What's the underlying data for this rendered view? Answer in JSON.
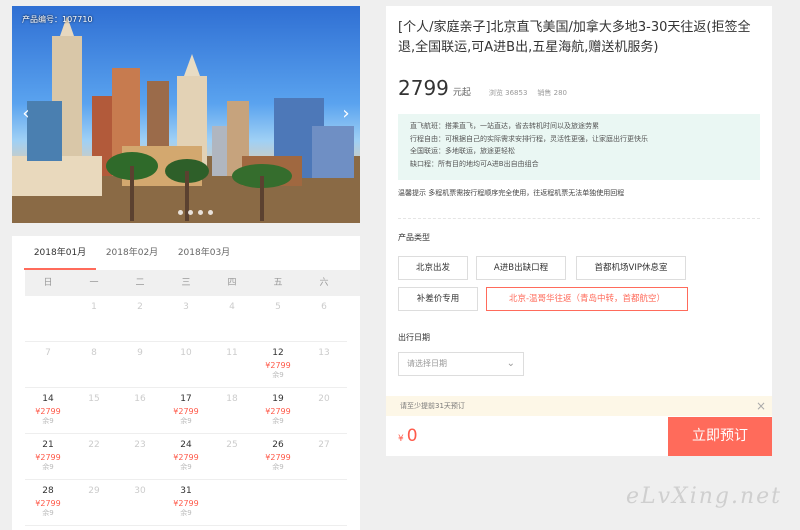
{
  "gallery": {
    "product_code": "产品编号：107710",
    "prev": "‹",
    "next": "›"
  },
  "calendar": {
    "months": [
      "2018年01月",
      "2018年02月",
      "2018年03月"
    ],
    "weekdays": [
      "日",
      "一",
      "二",
      "三",
      "四",
      "五",
      "六"
    ],
    "weeks": [
      [
        {
          "d": ""
        },
        {
          "d": "1",
          "dim": true
        },
        {
          "d": "2",
          "dim": true
        },
        {
          "d": "3",
          "dim": true
        },
        {
          "d": "4",
          "dim": true
        },
        {
          "d": "5",
          "dim": true
        },
        {
          "d": "6",
          "dim": true
        }
      ],
      [
        {
          "d": "7",
          "dim": true
        },
        {
          "d": "8",
          "dim": true
        },
        {
          "d": "9",
          "dim": true
        },
        {
          "d": "10",
          "dim": true
        },
        {
          "d": "11",
          "dim": true
        },
        {
          "d": "12",
          "p": "¥2799",
          "s": "余9"
        },
        {
          "d": "13",
          "dim": true
        }
      ],
      [
        {
          "d": "14",
          "p": "¥2799",
          "s": "余9"
        },
        {
          "d": "15",
          "dim": true
        },
        {
          "d": "16",
          "dim": true
        },
        {
          "d": "17",
          "p": "¥2799",
          "s": "余9"
        },
        {
          "d": "18",
          "dim": true
        },
        {
          "d": "19",
          "p": "¥2799",
          "s": "余9"
        },
        {
          "d": "20",
          "dim": true
        }
      ],
      [
        {
          "d": "21",
          "p": "¥2799",
          "s": "余9"
        },
        {
          "d": "22",
          "dim": true
        },
        {
          "d": "23",
          "dim": true
        },
        {
          "d": "24",
          "p": "¥2799",
          "s": "余9"
        },
        {
          "d": "25",
          "dim": true
        },
        {
          "d": "26",
          "p": "¥2799",
          "s": "余9"
        },
        {
          "d": "27",
          "dim": true
        }
      ],
      [
        {
          "d": "28",
          "p": "¥2799",
          "s": "余9"
        },
        {
          "d": "29",
          "dim": true
        },
        {
          "d": "30",
          "dim": true
        },
        {
          "d": "31",
          "p": "¥2799",
          "s": "余9"
        },
        {
          "d": ""
        },
        {
          "d": ""
        },
        {
          "d": ""
        }
      ]
    ]
  },
  "product": {
    "title": "[个人/家庭亲子]北京直飞美国/加拿大多地3-30天往返(拒签全退,全国联运,可A进B出,五星海航,赠送机服务)",
    "price": "2799",
    "price_unit": "元起",
    "views": "浏览 36853",
    "sales": "销售 280",
    "info": [
      "直飞航班：搭乘直飞，一站直达，省去转机时间以及旅途劳累",
      "行程自由：可根据自己的实际需求安排行程，灵活性更强，让家庭出行更快乐",
      "全国联运：多地联运，旅途更轻松",
      "缺口程：所有目的地均可A进B出自由组合"
    ],
    "tip": "温馨提示    多程机票需按行程顺序完全使用，往返程机票无法单独使用回程",
    "type_label": "产品类型",
    "types": [
      "北京出发",
      "A进B出缺口程",
      "首都机场VIP休息室",
      "补差价专用",
      "北京-温哥华往返（青岛中转，首都航空）"
    ],
    "date_label": "出行日期",
    "date_placeholder": "请选择日期",
    "notice": "请至少提前31天预订",
    "notice_close": "×",
    "currency": "¥",
    "total": "0",
    "book_label": "立即预订"
  },
  "watermark": "eLvXing.net",
  "colors": {
    "accent": "#ff6b5b",
    "price_red": "#ff5a4a",
    "info_bg": "#eaf7f3"
  }
}
